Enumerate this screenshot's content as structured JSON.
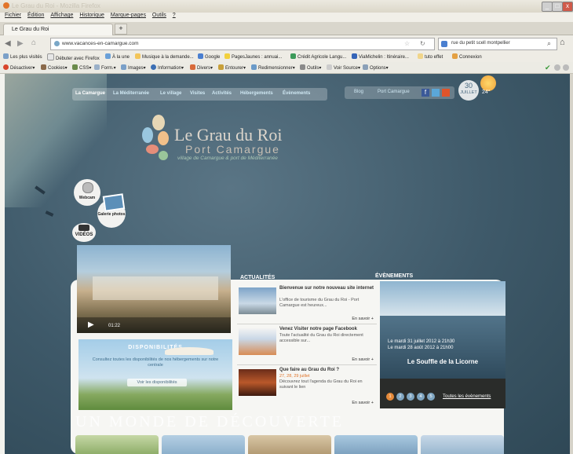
{
  "window": {
    "title": "Le Grau du Roi - Mozilla Firefox"
  },
  "menu": [
    "Fichier",
    "Édition",
    "Affichage",
    "Historique",
    "Marque-pages",
    "Outils",
    "?"
  ],
  "tab": {
    "label": "Le Grau du Roi",
    "new_tab": "+"
  },
  "address": {
    "url": "www.vacances-en-camargue.com",
    "search": "rue du petit scell montpellier"
  },
  "bookmarks": [
    "Les plus visités",
    "Débuter avec Firefox",
    "À la une",
    "Musique à la demande...",
    "Google",
    "PagesJaunes : annuai...",
    "Crédit Agricole Langu...",
    "ViaMichelin : Itinéraire...",
    "tuto effet",
    "Connexion"
  ],
  "toolbar2": [
    "Désactiver▾",
    "Cookies▾",
    "CSS▾",
    "Form.▾",
    "Images▾",
    "Information▾",
    "Divers▾",
    "Entourer▾",
    "Redimensionner▾",
    "Outils▾",
    "Voir Source▾",
    "Options▾"
  ],
  "site": {
    "nav": [
      "La Camargue",
      "La Méditerranée",
      "Le village",
      "Visites",
      "Activités",
      "Hébergements",
      "Évènements"
    ],
    "nav_secondary": [
      "Blog",
      "Port Camargue"
    ],
    "weather": {
      "day": "30",
      "month": "JUILLET",
      "temp": "24°"
    },
    "logo": {
      "title": "Le Grau du Roi",
      "subtitle": "Port Camargue",
      "tagline": "village de Camargue & port de Méditerranée"
    },
    "bubbles": {
      "webcam": "Webcam",
      "gallery": "Galerie photos",
      "videos": "VIDÉOS"
    },
    "video": {
      "time": "01:22"
    },
    "dispo": {
      "title": "DISPONIBILITÉS",
      "text": "Consultez toutes les disponibilités de nos hébergements sur notre centrale",
      "button": "Voir les disponibilités"
    },
    "actu": {
      "heading": "ACTUALITÉS",
      "items": [
        {
          "title": "Bienvenue sur notre nouveau site internet",
          "text": "L'office de tourisme du Grau du Roi - Port Camargue est heureux...",
          "more": "En savoir +"
        },
        {
          "title": "Venez Visiter notre page Facebook",
          "text": "Toute l'actualité du Grau du Roi directement accessible sur...",
          "more": "En savoir +"
        },
        {
          "title": "Que faire au Grau du Roi ?",
          "date": "27, 28, 29 juillet",
          "text": "Découvrez tout l'agenda du Grau du Roi en suivant le lien",
          "more": "En savoir +"
        }
      ]
    },
    "events": {
      "heading": "ÉVÈNEMENTS",
      "date1": "Le mardi 31 juillet 2012 à 21h30",
      "date2": "Le mardi 28 août 2012 à 21h00",
      "title": "Le Souffle de la Licorne",
      "pages": [
        "1",
        "2",
        "3",
        "4",
        "5"
      ],
      "all": "Toutes les évènements"
    },
    "monde": "UN MONDE DE DÉCOUVERTE"
  }
}
